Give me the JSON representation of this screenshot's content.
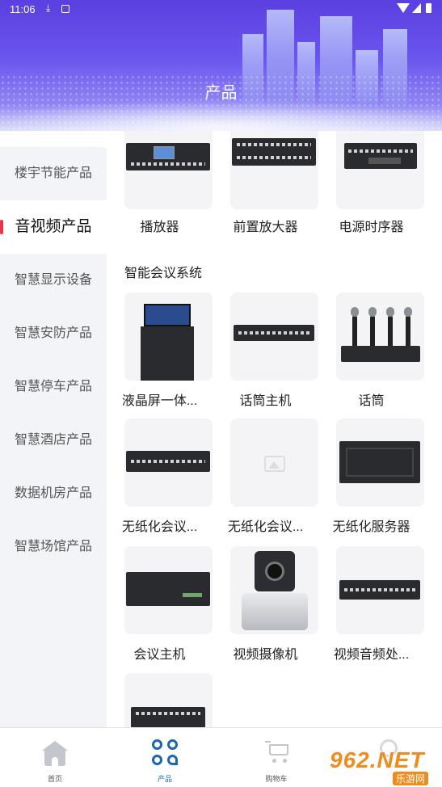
{
  "status_bar": {
    "time": "11:06"
  },
  "header": {
    "title": "产品"
  },
  "sidebar": {
    "items": [
      {
        "label": "楼宇节能产品",
        "active": false
      },
      {
        "label": "音视频产品",
        "active": true
      },
      {
        "label": "智慧显示设备",
        "active": false
      },
      {
        "label": "智慧安防产品",
        "active": false
      },
      {
        "label": "智慧停车产品",
        "active": false
      },
      {
        "label": "智慧酒店产品",
        "active": false
      },
      {
        "label": "数据机房产品",
        "active": false
      },
      {
        "label": "智慧场馆产品",
        "active": false
      }
    ]
  },
  "main": {
    "top_row": [
      {
        "label": "播放器"
      },
      {
        "label": "前置放大器"
      },
      {
        "label": "电源时序器"
      }
    ],
    "section": {
      "title": "智能会议系统"
    },
    "products": [
      {
        "label": "液晶屏一体..."
      },
      {
        "label": "话筒主机"
      },
      {
        "label": "话筒"
      },
      {
        "label": "无纸化会议..."
      },
      {
        "label": "无纸化会议..."
      },
      {
        "label": "无纸化服务器"
      },
      {
        "label": "会议主机"
      },
      {
        "label": "视频摄像机"
      },
      {
        "label": "视频音频处..."
      }
    ]
  },
  "bottom_nav": {
    "items": [
      {
        "label": "首页",
        "icon": "home-icon",
        "active": false
      },
      {
        "label": "产品",
        "icon": "products-icon",
        "active": true
      },
      {
        "label": "购物车",
        "icon": "cart-icon",
        "active": false
      },
      {
        "label": "",
        "icon": "user-icon",
        "active": false
      }
    ]
  },
  "watermark": {
    "brand": "962.NET",
    "sub": "乐游网"
  },
  "colors": {
    "accent": "#e8334a",
    "nav_active": "#1a66b5",
    "header": "#5b3fe0"
  }
}
